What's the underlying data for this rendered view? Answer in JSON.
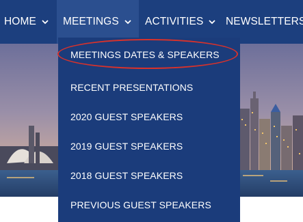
{
  "nav": {
    "items": [
      {
        "label": "HOME"
      },
      {
        "label": "MEETINGS"
      },
      {
        "label": "ACTIVITIES"
      },
      {
        "label": "NEWSLETTERS"
      }
    ]
  },
  "dropdown": {
    "items": [
      {
        "label": "MEETINGS DATES & SPEAKERS"
      },
      {
        "label": "RECENT PRESENTATIONS"
      },
      {
        "label": "2020 GUEST SPEAKERS"
      },
      {
        "label": "2019 GUEST SPEAKERS"
      },
      {
        "label": "2018 GUEST SPEAKERS"
      },
      {
        "label": "PREVIOUS GUEST SPEAKERS"
      }
    ]
  },
  "colors": {
    "nav_bg": "#1c3f7e",
    "nav_active_bg": "#2b4f8f",
    "dropdown_bg": "#1b3c7b",
    "highlight": "#d8322b",
    "text": "#ffffff"
  }
}
